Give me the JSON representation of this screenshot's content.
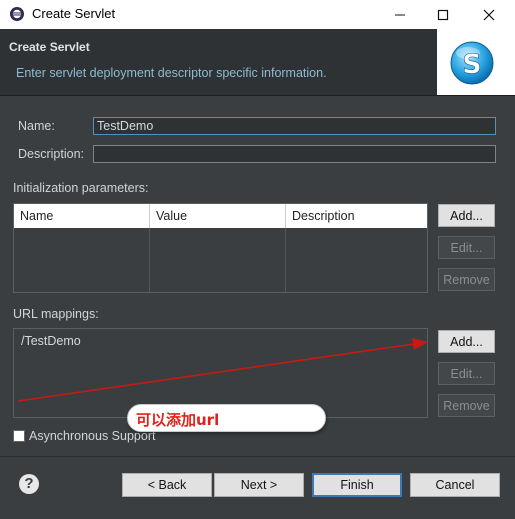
{
  "window": {
    "title": "Create Servlet",
    "minimize_icon": "minimize-icon",
    "maximize_icon": "maximize-icon",
    "close_icon": "close-icon"
  },
  "header": {
    "title": "Create Servlet",
    "description": "Enter servlet deployment descriptor specific information."
  },
  "form": {
    "name_label": "Name:",
    "name_value": "TestDemo",
    "description_label": "Description:",
    "description_value": ""
  },
  "init_params": {
    "label": "Initialization parameters:",
    "columns": [
      "Name",
      "Value",
      "Description"
    ],
    "buttons": {
      "add": "Add...",
      "edit": "Edit...",
      "remove": "Remove"
    }
  },
  "url_mappings": {
    "label": "URL mappings:",
    "items": [
      "/TestDemo"
    ],
    "buttons": {
      "add": "Add...",
      "edit": "Edit...",
      "remove": "Remove"
    }
  },
  "annotation": {
    "text": "可以添加url",
    "color": "#e0221b"
  },
  "async_support": {
    "label": "Asynchronous Support",
    "checked": false
  },
  "footer": {
    "help_icon": "help-icon",
    "back": "< Back",
    "next": "Next >",
    "finish": "Finish",
    "cancel": "Cancel"
  },
  "colors": {
    "background": "#3a3e40",
    "header_bg": "#2e3234",
    "desc_text": "#8dbbd2",
    "accent": "#3b78b5"
  }
}
